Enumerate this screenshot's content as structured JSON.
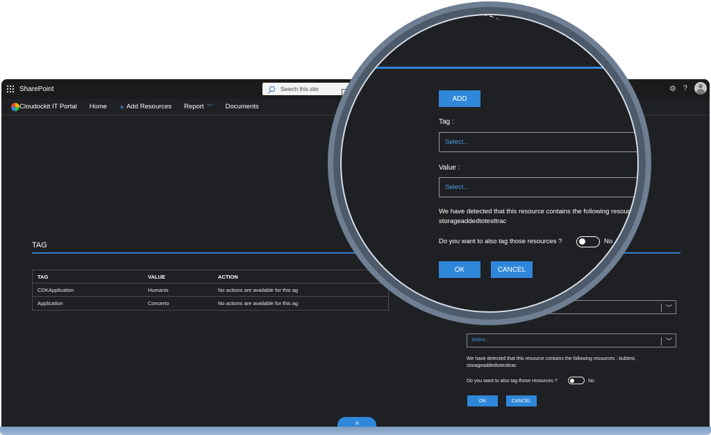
{
  "suite": {
    "brand": "SharePoint",
    "search_placeholder": "Search this site",
    "settings_icon": "gear-icon",
    "help_label": "?"
  },
  "nav": {
    "site_title": "Cloudockit IT Portal",
    "items": [
      {
        "label": "Home"
      },
      {
        "label": "Add Resources",
        "prefix": "+"
      },
      {
        "label": "Report",
        "suffix": "chevron-down"
      },
      {
        "label": "Documents"
      }
    ]
  },
  "tag_section": {
    "title": "TAG",
    "columns": [
      "TAG",
      "VALUE",
      "ACTION"
    ],
    "rows": [
      {
        "tag": "CDKApplication",
        "value": "Humanis",
        "action": "No actions are available for this  ag"
      },
      {
        "tag": "Application",
        "value": "Concerto",
        "action": "No actions are available for this  ag"
      }
    ]
  },
  "small_form": {
    "select_placeholder": "Select...",
    "detected_line1": "We have detected that this resource contains the following resources : kubtest,",
    "detected_line2": "storageaddedtotesttrac",
    "question": "Do you want to also tag those resources ?",
    "toggle_label": "No",
    "ok": "OK",
    "cancel": "CANCEL"
  },
  "lens": {
    "add": "ADD",
    "tag_label": "Tag :",
    "tag_placeholder": "Select...",
    "value_label": "Value :",
    "value_placeholder": "Select...",
    "detected_line1": "We have detected that this resource contains the following resource",
    "detected_line2": "storageaddedtotesttrac",
    "question": "Do you want to also tag those resources ?",
    "toggle_label": "No",
    "ok": "OK",
    "cancel": "CANCEL"
  },
  "scroll_glyph": "«",
  "colors": {
    "accent": "#2f87d9",
    "background": "#1f2023",
    "suitebar": "#1b1b1d",
    "lens_frame": "#6e7f93"
  }
}
